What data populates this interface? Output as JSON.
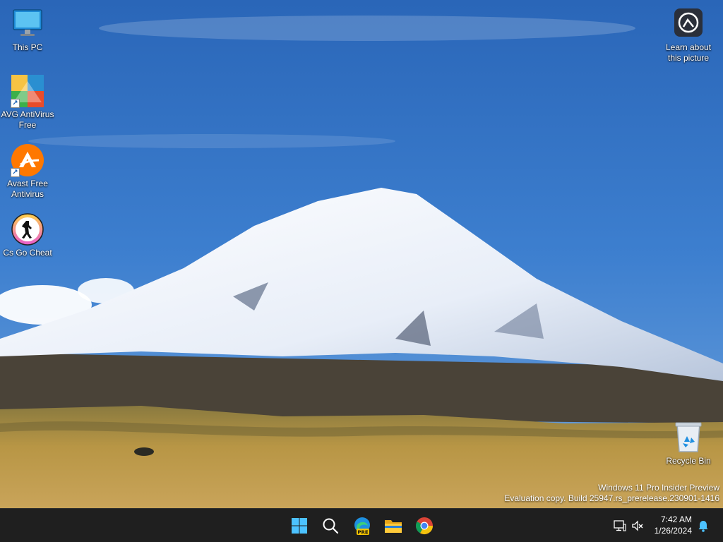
{
  "desktop": {
    "icons": [
      {
        "label": "This PC",
        "icon": "monitor-icon"
      },
      {
        "label": "AVG AntiVirus Free",
        "icon": "avg-icon"
      },
      {
        "label": "Avast Free Antivirus",
        "icon": "avast-icon"
      },
      {
        "label": "Cs Go Cheat",
        "icon": "csgo-icon"
      },
      {
        "label": "Learn about this picture",
        "icon": "camera-icon"
      },
      {
        "label": "Recycle Bin",
        "icon": "recycle-bin-icon"
      }
    ],
    "watermark": {
      "line1": "Windows 11 Pro Insider Preview",
      "line2": "Evaluation copy. Build 25947.rs_prerelease.230901-1416"
    }
  },
  "taskbar": {
    "apps": [
      {
        "name": "Start",
        "icon": "windows-logo-icon"
      },
      {
        "name": "Search",
        "icon": "search-icon"
      },
      {
        "name": "Microsoft Edge",
        "icon": "edge-icon",
        "badge": "PRE"
      },
      {
        "name": "File Explorer",
        "icon": "folder-icon"
      },
      {
        "name": "Google Chrome",
        "icon": "chrome-icon"
      }
    ],
    "tray": {
      "time": "7:42 AM",
      "date": "1/26/2024",
      "icons": [
        "network-icon",
        "volume-muted-icon",
        "notification-bell-icon"
      ]
    }
  },
  "colors": {
    "taskbar_bg": "#1f1f1f",
    "accent": "#0078d4",
    "sky_top": "#2f6fc0",
    "snow": "#f2f5fb",
    "grass": "#b89645"
  }
}
